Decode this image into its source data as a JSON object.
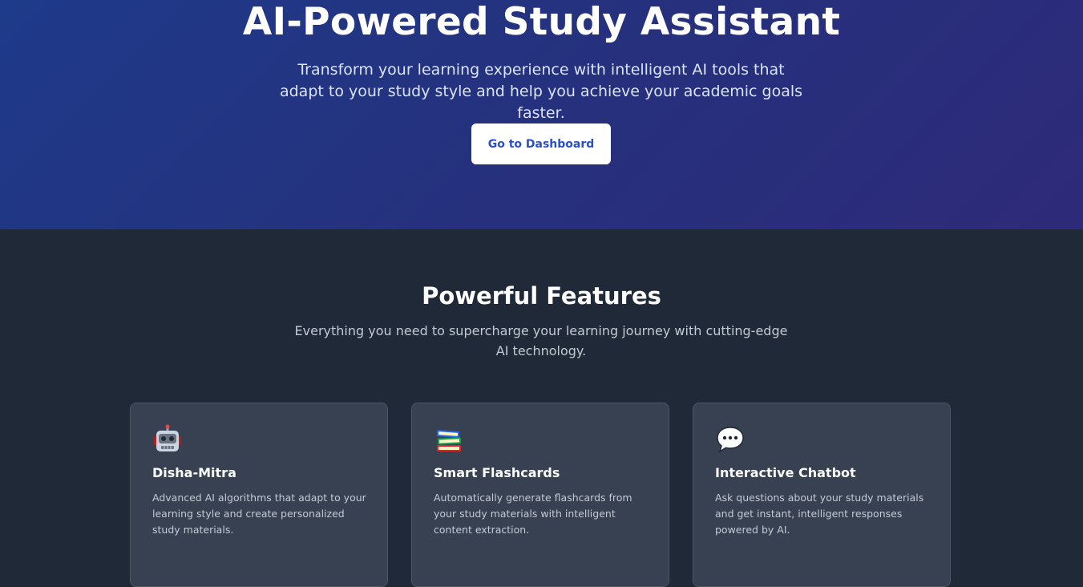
{
  "hero": {
    "title": "AI-Powered Study Assistant",
    "subtitle": "Transform your learning experience with intelligent AI tools that adapt to your study style and help you achieve your academic goals faster.",
    "cta_label": "Go to Dashboard"
  },
  "features": {
    "title": "Powerful Features",
    "subtitle": "Everything you need to supercharge your learning journey with cutting-edge AI technology.",
    "cards": [
      {
        "icon": "robot-icon",
        "title": "Disha-Mitra",
        "description": "Advanced AI algorithms that adapt to your learning style and create personalized study materials."
      },
      {
        "icon": "books-icon",
        "title": "Smart Flashcards",
        "description": "Automatically generate flashcards from your study materials with intelligent content extraction."
      },
      {
        "icon": "speech-bubble-icon",
        "title": "Interactive Chatbot",
        "description": "Ask questions about your study materials and get instant, intelligent responses powered by AI."
      }
    ]
  },
  "colors": {
    "hero_gradient_start": "#1e3a8a",
    "hero_gradient_end": "#2e2a7a",
    "section_bg": "#1f2937",
    "card_bg": "#374151",
    "cta_text": "#2a4fc7"
  }
}
